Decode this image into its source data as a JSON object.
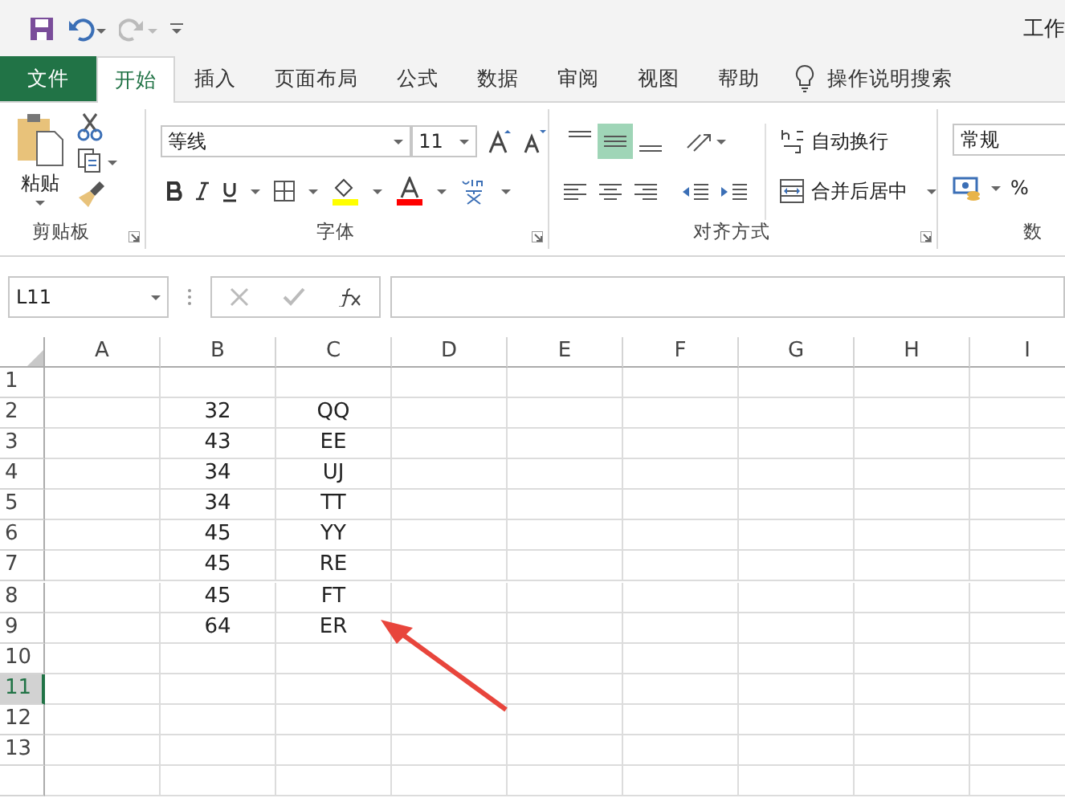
{
  "window": {
    "title": "工作"
  },
  "tabs": [
    {
      "label": "文件",
      "kind": "file",
      "selected": false
    },
    {
      "label": "开始",
      "kind": "tab",
      "selected": true
    },
    {
      "label": "插入",
      "kind": "tab",
      "selected": false
    },
    {
      "label": "页面布局",
      "kind": "tab",
      "selected": false
    },
    {
      "label": "公式",
      "kind": "tab",
      "selected": false
    },
    {
      "label": "数据",
      "kind": "tab",
      "selected": false
    },
    {
      "label": "审阅",
      "kind": "tab",
      "selected": false
    },
    {
      "label": "视图",
      "kind": "tab",
      "selected": false
    },
    {
      "label": "帮助",
      "kind": "tab",
      "selected": false
    }
  ],
  "tell_me": "操作说明搜索",
  "ribbon": {
    "clipboard": {
      "paste": "粘贴",
      "title": "剪贴板"
    },
    "font": {
      "font_name": "等线",
      "font_size": "11",
      "title": "字体"
    },
    "alignment": {
      "vertical": [
        {
          "selected": false
        },
        {
          "selected": true
        },
        {
          "selected": false
        }
      ],
      "wrap_text": "自动换行",
      "merge": "合并后居中",
      "title": "对齐方式"
    },
    "number": {
      "format": "常规",
      "percent": "%",
      "title": "数"
    }
  },
  "formula_bar": {
    "name_box": "L11"
  },
  "sheet": {
    "columns": [
      "A",
      "B",
      "C",
      "D",
      "E",
      "F",
      "G",
      "H",
      "I"
    ],
    "rows": [
      {
        "header": "1",
        "selected": false
      },
      {
        "header": "2",
        "b": "32",
        "c": "QQ",
        "selected": false
      },
      {
        "header": "3",
        "b": "43",
        "c": "EE",
        "selected": false
      },
      {
        "header": "4",
        "b": "34",
        "c": "UJ",
        "selected": false
      },
      {
        "header": "5",
        "b": "34",
        "c": "TT",
        "selected": false
      },
      {
        "header": "6",
        "b": "45",
        "c": "YY",
        "selected": false
      },
      {
        "header": "7",
        "b": "45",
        "c": "RE",
        "selected": false
      },
      {
        "header": "8",
        "b": "45",
        "c": "FT",
        "selected": false
      },
      {
        "header": "9",
        "b": "64",
        "c": "ER",
        "selected": false
      },
      {
        "header": "10",
        "selected": false
      },
      {
        "header": "11",
        "selected": true
      },
      {
        "header": "12",
        "selected": false
      },
      {
        "header": "13",
        "selected": false
      }
    ]
  }
}
